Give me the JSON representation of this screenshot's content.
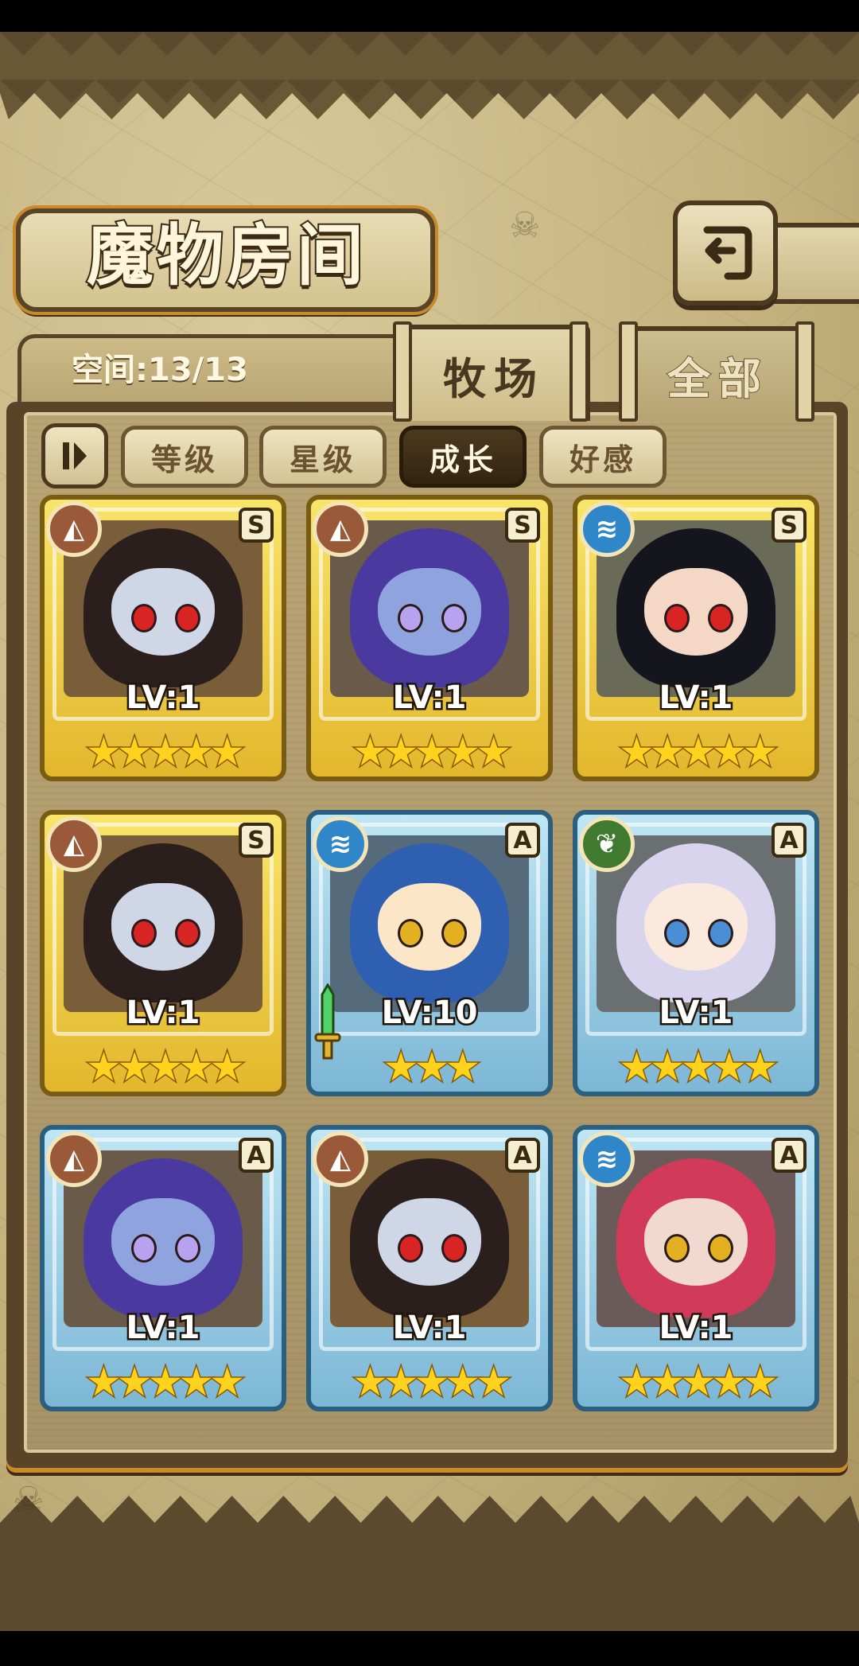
{
  "header": {
    "title": "魔物房间",
    "back_icon": "return-arrow-icon"
  },
  "space": {
    "label": "空间:13/13"
  },
  "tabs": [
    {
      "label": "牧场",
      "active": true
    },
    {
      "label": "全部",
      "active": false
    }
  ],
  "sort": {
    "toggle_icon": "sort-toggle-icon",
    "buttons": [
      {
        "label": "等级",
        "active": false
      },
      {
        "label": "星级",
        "active": false
      },
      {
        "label": "成长",
        "active": true
      },
      {
        "label": "好感",
        "active": false
      }
    ]
  },
  "monsters": [
    {
      "level": "LV:1",
      "stars": "★★★★★",
      "rank": "S",
      "element": "earth",
      "frame": "gold"
    },
    {
      "level": "LV:1",
      "stars": "★★★★★",
      "rank": "S",
      "element": "earth",
      "frame": "gold"
    },
    {
      "level": "LV:1",
      "stars": "★★★★★",
      "rank": "S",
      "element": "water",
      "frame": "gold"
    },
    {
      "level": "LV:1",
      "stars": "★★★★★",
      "rank": "S",
      "element": "earth",
      "frame": "gold"
    },
    {
      "level": "LV:10",
      "stars": "★★★",
      "rank": "A",
      "element": "water",
      "frame": "blue"
    },
    {
      "level": "LV:1",
      "stars": "★★★★★",
      "rank": "A",
      "element": "wood",
      "frame": "blue"
    },
    {
      "level": "LV:1",
      "stars": "★★★★★",
      "rank": "A",
      "element": "earth",
      "frame": "blue"
    },
    {
      "level": "LV:1",
      "stars": "★★★★★",
      "rank": "A",
      "element": "earth",
      "frame": "blue"
    },
    {
      "level": "LV:1",
      "stars": "★★★★★",
      "rank": "A",
      "element": "water",
      "frame": "blue"
    }
  ],
  "colors": {
    "earth": "#9a5a3a",
    "water": "#2f86c9",
    "wood": "#3f7a2e",
    "gold_frame": "#e8c232",
    "blue_frame": "#8cc6e0"
  }
}
